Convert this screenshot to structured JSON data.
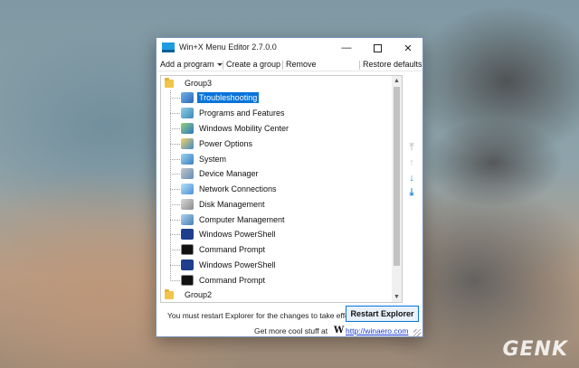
{
  "window": {
    "title": "Win+X Menu Editor 2.7.0.0",
    "minimize_glyph": "—",
    "close_glyph": "✕"
  },
  "toolbar": {
    "add_program": "Add a program",
    "create_group": "Create a group",
    "remove": "Remove",
    "restore_defaults": "Restore defaults"
  },
  "tree": {
    "groups": [
      {
        "label": "Group3",
        "items": [
          {
            "label": "Troubleshooting",
            "icon": "troubleshooting-icon",
            "selected": true
          },
          {
            "label": "Programs and Features",
            "icon": "programs-features-icon"
          },
          {
            "label": "Windows Mobility Center",
            "icon": "mobility-center-icon"
          },
          {
            "label": "Power Options",
            "icon": "power-options-icon"
          },
          {
            "label": "System",
            "icon": "system-icon"
          },
          {
            "label": "Device Manager",
            "icon": "device-manager-icon"
          },
          {
            "label": "Network Connections",
            "icon": "network-connections-icon"
          },
          {
            "label": "Disk Management",
            "icon": "disk-management-icon"
          },
          {
            "label": "Computer Management",
            "icon": "computer-management-icon"
          },
          {
            "label": "Windows PowerShell",
            "icon": "powershell-icon"
          },
          {
            "label": "Command Prompt",
            "icon": "command-prompt-icon"
          },
          {
            "label": "Windows PowerShell",
            "icon": "powershell-icon"
          },
          {
            "label": "Command Prompt",
            "icon": "command-prompt-icon"
          }
        ]
      },
      {
        "label": "Group2",
        "items": []
      }
    ]
  },
  "side_buttons": {
    "move_top": "⤒",
    "move_up": "↑",
    "move_down": "↓",
    "move_bottom": "⤓"
  },
  "status": {
    "message": "You must restart Explorer for the changes to take effect.",
    "restart_button": "Restart Explorer"
  },
  "footer": {
    "text": "Get more cool stuff at",
    "link": "http://winaero.com"
  },
  "watermark": "GENK",
  "colors": {
    "selection": "#0a74da",
    "link": "#1a3bd6",
    "accent_arrow": "#2a8ad6"
  }
}
